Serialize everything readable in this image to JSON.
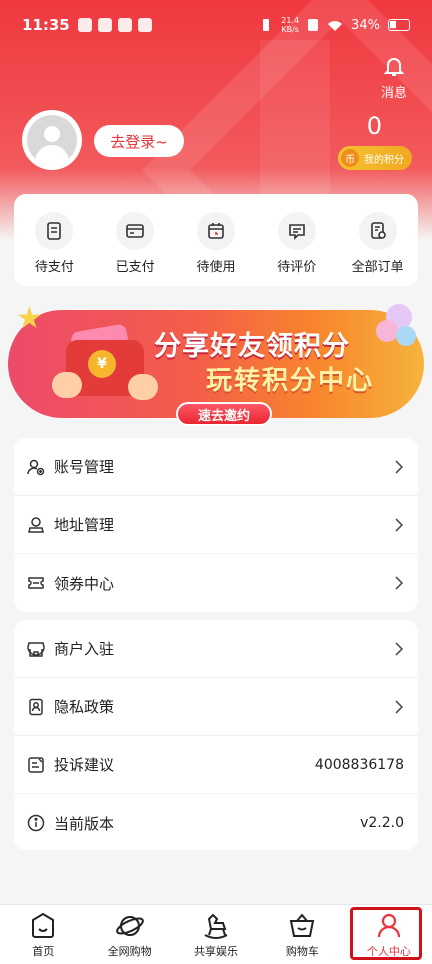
{
  "status_bar": {
    "time": "11:35",
    "net_speed": "21.4",
    "net_unit": "KB/s",
    "battery": "34%"
  },
  "header": {
    "message_label": "消息",
    "login_label": "去登录~",
    "points_value": "0",
    "points_label": "我的积分",
    "coin_glyph": "币"
  },
  "orders": [
    {
      "label": "待支付",
      "icon": "payment-pending-icon"
    },
    {
      "label": "已支付",
      "icon": "card-icon"
    },
    {
      "label": "待使用",
      "icon": "calendar-icon"
    },
    {
      "label": "待评价",
      "icon": "comment-icon"
    },
    {
      "label": "全部订单",
      "icon": "orders-icon"
    }
  ],
  "banner": {
    "line1": "分享好友领积分",
    "line2": "玩转积分中心",
    "button": "速去邀约",
    "coin_glyph": "¥"
  },
  "menu_group_1": [
    {
      "label": "账号管理",
      "icon": "account-icon"
    },
    {
      "label": "地址管理",
      "icon": "address-icon"
    },
    {
      "label": "领券中心",
      "icon": "coupon-icon"
    }
  ],
  "menu_group_2": [
    {
      "label": "商户入驻",
      "icon": "store-icon"
    },
    {
      "label": "隐私政策",
      "icon": "privacy-icon"
    },
    {
      "label": "投诉建议",
      "icon": "feedback-icon",
      "value": "4008836178"
    },
    {
      "label": "当前版本",
      "icon": "info-icon",
      "value": "v2.2.0"
    }
  ],
  "tabbar": [
    {
      "label": "首页",
      "icon": "home-icon"
    },
    {
      "label": "全网购物",
      "icon": "planet-icon"
    },
    {
      "label": "共享娱乐",
      "icon": "rocking-horse-icon"
    },
    {
      "label": "购物车",
      "icon": "cart-icon"
    },
    {
      "label": "个人中心",
      "icon": "person-icon",
      "active": true
    }
  ],
  "colors": {
    "brand_red": "#e8343a",
    "header_red": "#f0383f",
    "gold": "#f6c130"
  }
}
